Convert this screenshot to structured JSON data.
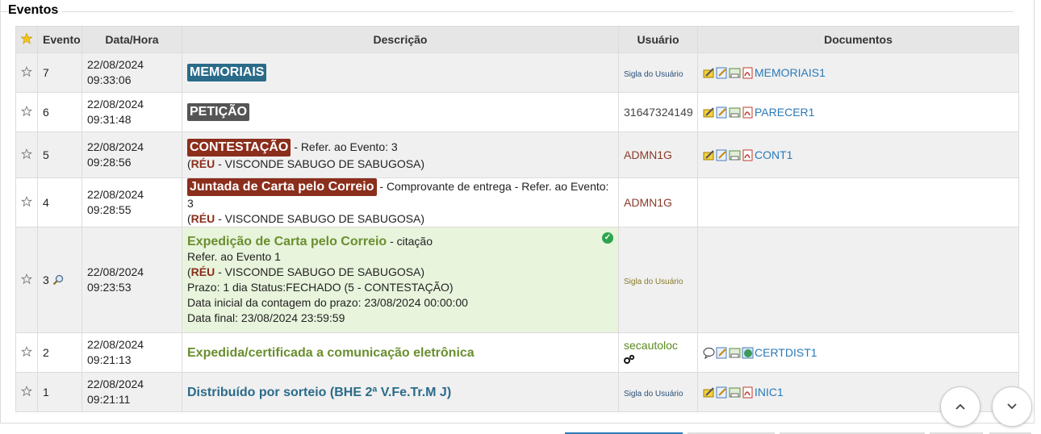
{
  "legend": "Eventos",
  "headers": {
    "evento": "Evento",
    "datahora": "Data/Hora",
    "descricao": "Descrição",
    "usuario": "Usuário",
    "documentos": "Documentos"
  },
  "rows": [
    {
      "num": "7",
      "date": "22/08/2024",
      "time": "09:33:06",
      "badge": "MEMORIAIS",
      "usuario": "Sigla do Usuário",
      "doc": "MEMORIAIS1"
    },
    {
      "num": "6",
      "date": "22/08/2024",
      "time": "09:31:48",
      "badge": "PETIÇÃO",
      "usuario": "31647324149",
      "doc": "PARECER1"
    },
    {
      "num": "5",
      "date": "22/08/2024",
      "time": "09:28:56",
      "badge": "CONTESTAÇÃO",
      "suffix": " - Refer. ao Evento: 3",
      "party_open": "(",
      "party": "RÉU",
      "party_rest": " - VISCONDE SABUGO DE SABUGOSA)",
      "usuario": "ADMN1G",
      "doc": "CONT1"
    },
    {
      "num": "4",
      "date": "22/08/2024",
      "time": "09:28:55",
      "badge": "Juntada de Carta pelo Correio",
      "suffix": " - Comprovante de entrega - Refer. ao Evento: 3",
      "party_open": "(",
      "party": "RÉU",
      "party_rest": " - VISCONDE SABUGO DE SABUGOSA)",
      "usuario": "ADMN1G"
    },
    {
      "num": "3",
      "date": "22/08/2024",
      "time": "09:23:53",
      "title": "Expedição de Carta pelo Correio",
      "title_suffix": " - citação",
      "line2": "Refer. ao Evento 1",
      "party_open": "(",
      "party": "RÉU",
      "party_rest": " - VISCONDE SABUGO DE SABUGOSA)",
      "line4": "Prazo: 1 dia Status:FECHADO (5 - CONTESTAÇÃO)",
      "line5": "Data inicial da contagem do prazo: 23/08/2024 00:00:00",
      "line6": "Data final: 23/08/2024 23:59:59",
      "usuario": "Sigla do Usuário"
    },
    {
      "num": "2",
      "date": "22/08/2024",
      "time": "09:21:13",
      "title": "Expedida/certificada a comunicação eletrônica",
      "usuario": "secautoloc",
      "doc": "CERTDIST1"
    },
    {
      "num": "1",
      "date": "22/08/2024",
      "time": "09:21:11",
      "title": "Distribuído por sorteio (BHE 2ª V.Fe.Tr.M J)",
      "usuario": "Sigla do Usuário",
      "doc": "INIC1"
    }
  ]
}
